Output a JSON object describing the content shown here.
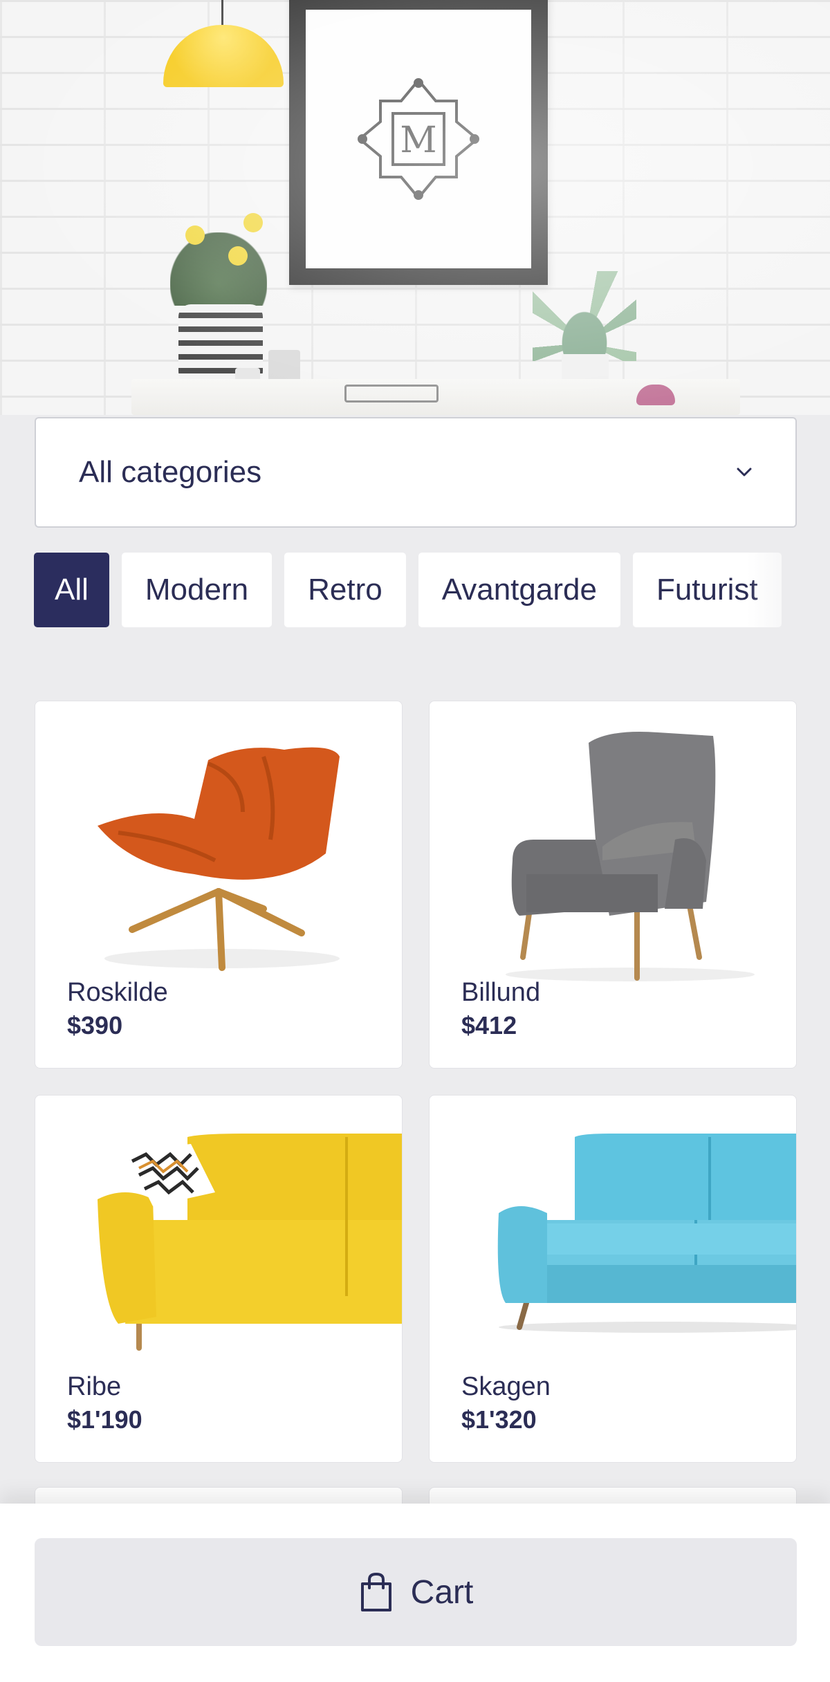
{
  "hero": {
    "logo_letter": "M",
    "colors": {
      "lamp": "#f5c400",
      "frame": "#1c1c1c"
    }
  },
  "category_select": {
    "value": "All categories",
    "icon": "chevron-down-icon"
  },
  "filter_chips": [
    {
      "label": "All",
      "active": true
    },
    {
      "label": "Modern",
      "active": false
    },
    {
      "label": "Retro",
      "active": false
    },
    {
      "label": "Avantgarde",
      "active": false
    },
    {
      "label": "Futurist",
      "active": false
    }
  ],
  "products": [
    {
      "name": "Roskilde",
      "price": "$390",
      "color": "#d4581c"
    },
    {
      "name": "Billund",
      "price": "$412",
      "color": "#7a7a7c"
    },
    {
      "name": "Ribe",
      "price": "$1'190",
      "color": "#f3cf2c"
    },
    {
      "name": "Skagen",
      "price": "$1'320",
      "color": "#6cc9e2"
    }
  ],
  "cart": {
    "label": "Cart",
    "icon": "shopping-bag-icon"
  },
  "colors": {
    "primary": "#2b2d5e",
    "background": "#ececee",
    "text": "#2b2d55"
  }
}
